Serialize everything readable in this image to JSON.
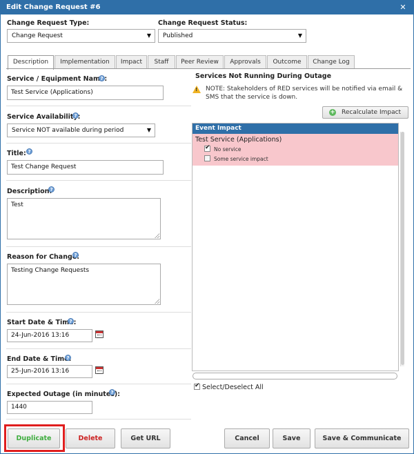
{
  "dialog": {
    "title": "Edit Change Request #6"
  },
  "header": {
    "type_label": "Change Request Type:",
    "type_value": "Change Request",
    "status_label": "Change Request Status:",
    "status_value": "Published"
  },
  "tabs": [
    {
      "label": "Description",
      "active": true
    },
    {
      "label": "Implementation"
    },
    {
      "label": "Impact"
    },
    {
      "label": "Staff"
    },
    {
      "label": "Peer Review"
    },
    {
      "label": "Approvals"
    },
    {
      "label": "Outcome"
    },
    {
      "label": "Change Log"
    }
  ],
  "form": {
    "service_label": "Service / Equipment Name:",
    "service_value": "Test Service (Applications)",
    "availability_label": "Service Availability:",
    "availability_value": "Service NOT available during period",
    "title_label": "Title:",
    "title_value": "Test Change Request",
    "description_label": "Description:",
    "description_value": "Test",
    "reason_label": "Reason for Change:",
    "reason_value": "Testing Change Requests",
    "start_label": "Start Date & Time:",
    "start_value": "24-Jun-2016 13:16",
    "end_label": "End Date & Time:",
    "end_value": "25-Jun-2016 13:16",
    "outage_label": "Expected Outage (in minutes):",
    "outage_value": "1440"
  },
  "services": {
    "heading": "Services Not Running During Outage",
    "note": "NOTE: Stakeholders of RED services will be notified via email & SMS that the service is down.",
    "recalc_label": "Recalculate Impact",
    "panel_heading": "Event Impact",
    "service_name": "Test Service (Applications)",
    "option_no_service": "No service",
    "option_some_impact": "Some service impact",
    "no_service_checked": true,
    "some_impact_checked": false,
    "select_all_label": "Select/Deselect All",
    "select_all_checked": true,
    "impact_color": "#f8c7cc"
  },
  "buttons": {
    "duplicate": "Duplicate",
    "delete": "Delete",
    "get_url": "Get URL",
    "cancel": "Cancel",
    "save": "Save",
    "save_communicate": "Save & Communicate"
  },
  "colors": {
    "title_bar": "#2f6fa8",
    "delete_text": "#cc2222",
    "duplicate_text": "#3fae3f",
    "highlight": "#e01e1e"
  }
}
